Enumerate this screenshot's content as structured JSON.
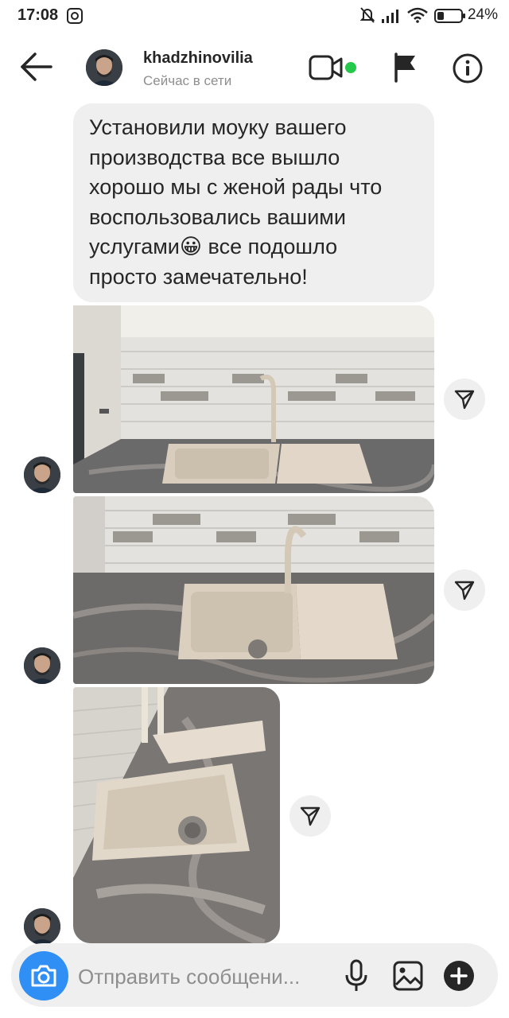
{
  "status_bar": {
    "time": "17:08",
    "battery": "24%"
  },
  "header": {
    "username": "khadzhinovilia",
    "presence": "Сейчас в сети"
  },
  "message": {
    "text": "Установили моуку вашего\nпроизводства все вышло\nхорошо мы с женой рады что\nвоспользовались вашими\nуслугами",
    "emoji": "😀",
    "text_after_emoji": " все подошло\nпросто замечательно!"
  },
  "photos": [
    {
      "alt": "sink-photo-1"
    },
    {
      "alt": "sink-photo-2"
    },
    {
      "alt": "sink-photo-3"
    }
  ],
  "composer": {
    "placeholder": "Отправить сообщени..."
  },
  "colors": {
    "accent": "#2f8ff5",
    "online": "#25c84a",
    "bubble": "#efefef"
  },
  "icons": [
    "back-arrow-icon",
    "video-call-icon",
    "flag-icon",
    "info-icon",
    "share-icon",
    "camera-icon",
    "microphone-icon",
    "gallery-icon",
    "plus-icon"
  ]
}
